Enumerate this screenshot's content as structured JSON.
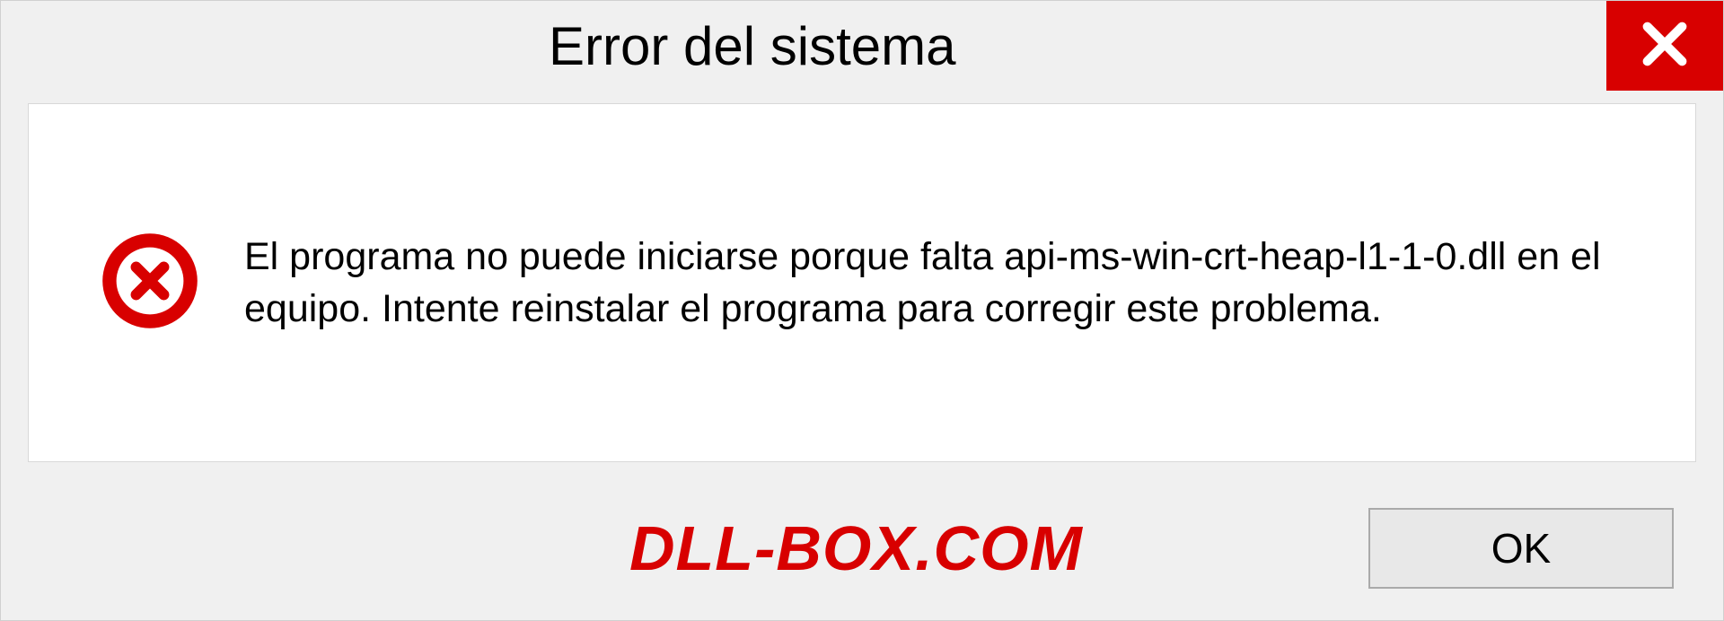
{
  "titlebar": {
    "title": "Error del sistema"
  },
  "content": {
    "message": "El programa no puede iniciarse porque falta api-ms-win-crt-heap-l1-1-0.dll en el equipo. Intente reinstalar el programa para corregir este problema."
  },
  "footer": {
    "watermark": "DLL-BOX.COM",
    "ok_label": "OK"
  },
  "colors": {
    "accent_red": "#d80000",
    "background": "#f0f0f0",
    "content_bg": "#ffffff"
  }
}
